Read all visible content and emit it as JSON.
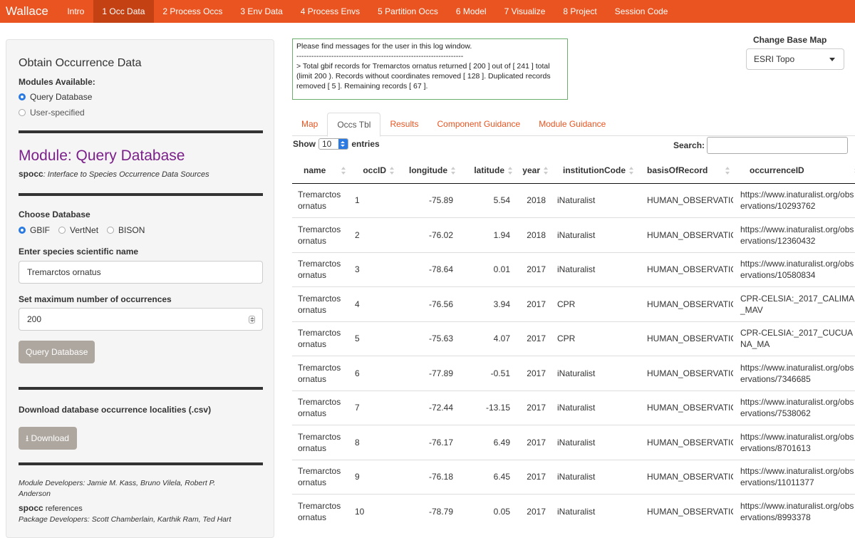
{
  "nav": {
    "brand": "Wallace",
    "items": [
      "Intro",
      "1 Occ Data",
      "2 Process Occs",
      "3 Env Data",
      "4 Process Envs",
      "5 Partition Occs",
      "6 Model",
      "7 Visualize",
      "8 Project",
      "Session Code"
    ],
    "active_index": 1
  },
  "sidebar": {
    "heading": "Obtain Occurrence Data",
    "modules_label": "Modules Available:",
    "modules": [
      "Query Database",
      "User-specified"
    ],
    "module_title": "Module: Query Database",
    "module_pkg": "spocc",
    "module_desc": ": Interface to Species Occurrence Data Sources",
    "choose_db_label": "Choose Database",
    "databases": [
      "GBIF",
      "VertNet",
      "BISON"
    ],
    "species_label": "Enter species scientific name",
    "species_value": "Tremarctos ornatus",
    "max_label": "Set maximum number of occurrences",
    "max_value": "200",
    "query_button": "Query Database",
    "download_label": "Download database occurrence localities (.csv)",
    "download_button": "Download",
    "dev_text": "Module Developers: Jamie M. Kass, Bruno Vilela, Robert P. Anderson",
    "refs_pkg": "spocc",
    "refs_text": " references",
    "refs_line2": "Package Developers: Scott Chamberlain, Karthik Ram, Ted Hart"
  },
  "log": {
    "line1": "Please find messages for the user in this log window.",
    "separator": "-------------------------------------------------------------------",
    "message": "> Total gbif records for Tremarctos ornatus returned [ 200 ] out of [ 241 ] total (limit 200 ). Records without coordinates removed [ 128 ]. Duplicated records removed [ 5 ]. Remaining records [ 67 ]."
  },
  "basemap": {
    "label": "Change Base Map",
    "value": "ESRI Topo"
  },
  "tabs": [
    "Map",
    "Occs Tbl",
    "Results",
    "Component Guidance",
    "Module Guidance"
  ],
  "table_controls": {
    "show": "Show",
    "entries_value": "10",
    "entries": "entries",
    "search": "Search:"
  },
  "table": {
    "headers": [
      "name",
      "occID",
      "longitude",
      "latitude",
      "year",
      "institutionCode",
      "basisOfRecord",
      "occurrenceID"
    ],
    "rows": [
      [
        "Tremarctos ornatus",
        "1",
        "-75.89",
        "5.54",
        "2018",
        "iNaturalist",
        "HUMAN_OBSERVATION",
        "https://www.inaturalist.org/observations/10293762"
      ],
      [
        "Tremarctos ornatus",
        "2",
        "-76.02",
        "1.94",
        "2018",
        "iNaturalist",
        "HUMAN_OBSERVATION",
        "https://www.inaturalist.org/observations/12360432"
      ],
      [
        "Tremarctos ornatus",
        "3",
        "-78.64",
        "0.01",
        "2017",
        "iNaturalist",
        "HUMAN_OBSERVATION",
        "https://www.inaturalist.org/observations/10580834"
      ],
      [
        "Tremarctos ornatus",
        "4",
        "-76.56",
        "3.94",
        "2017",
        "CPR",
        "HUMAN_OBSERVATION",
        "CPR-CELSIA:_2017_CALIMA_MAV"
      ],
      [
        "Tremarctos ornatus",
        "5",
        "-75.63",
        "4.07",
        "2017",
        "CPR",
        "HUMAN_OBSERVATION",
        "CPR-CELSIA:_2017_CUCUANA_MA"
      ],
      [
        "Tremarctos ornatus",
        "6",
        "-77.89",
        "-0.51",
        "2017",
        "iNaturalist",
        "HUMAN_OBSERVATION",
        "https://www.inaturalist.org/observations/7346685"
      ],
      [
        "Tremarctos ornatus",
        "7",
        "-72.44",
        "-13.15",
        "2017",
        "iNaturalist",
        "HUMAN_OBSERVATION",
        "https://www.inaturalist.org/observations/7538062"
      ],
      [
        "Tremarctos ornatus",
        "8",
        "-76.17",
        "6.49",
        "2017",
        "iNaturalist",
        "HUMAN_OBSERVATION",
        "https://www.inaturalist.org/observations/8701613"
      ],
      [
        "Tremarctos ornatus",
        "9",
        "-76.18",
        "6.45",
        "2017",
        "iNaturalist",
        "HUMAN_OBSERVATION",
        "https://www.inaturalist.org/observations/11011377"
      ],
      [
        "Tremarctos ornatus",
        "10",
        "-78.79",
        "0.05",
        "2017",
        "iNaturalist",
        "HUMAN_OBSERVATION",
        "https://www.inaturalist.org/observations/8993378"
      ]
    ]
  },
  "colors": {
    "brand": "#e95420",
    "brand_active": "#c34113",
    "module_title": "#7b1f8a",
    "log_border": "#6cae6c",
    "radio_selected": "#2a7ae2"
  }
}
